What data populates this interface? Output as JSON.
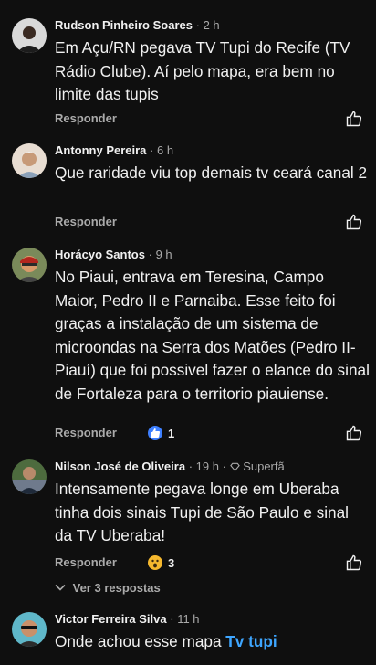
{
  "comments": [
    {
      "author": "Rudson Pinheiro Soares",
      "time": "2 h",
      "text": "Em Açu/RN pegava TV Tupi do Recife (TV Rádio Clube). Aí pelo mapa, era bem no limite das tupis",
      "reply_label": "Responder"
    },
    {
      "author": "Antonny Pereira",
      "time": "6 h",
      "text": "Que raridade viu top demais tv ceará canal 2",
      "reply_label": "Responder"
    },
    {
      "author": "Horácyo Santos",
      "time": "9 h",
      "text": "No Piaui, entrava em Teresina, Campo Maior, Pedro II e Parnaiba. Esse feito foi graças a instalação de um sistema de microondas na Serra dos Matões (Pedro II-Piauí) que foi possivel fazer o elance do sinal de Fortaleza para o territorio piauiense.",
      "reply_label": "Responder",
      "reaction_count": "1"
    },
    {
      "author": "Nilson José de Oliveira",
      "time": "19 h",
      "badge": "Superfã",
      "text": "Intensamente pegava longe em Uberaba tinha dois sinais Tupi de São Paulo e sinal da TV Uberaba!",
      "reply_label": "Responder",
      "reaction_count": "3",
      "view_replies": "Ver 3 respostas"
    },
    {
      "author": "Victor Ferreira Silva",
      "time": "11 h",
      "text_before": "Onde achou esse mapa ",
      "link_text": "Tv tupi"
    }
  ],
  "separator": "·"
}
